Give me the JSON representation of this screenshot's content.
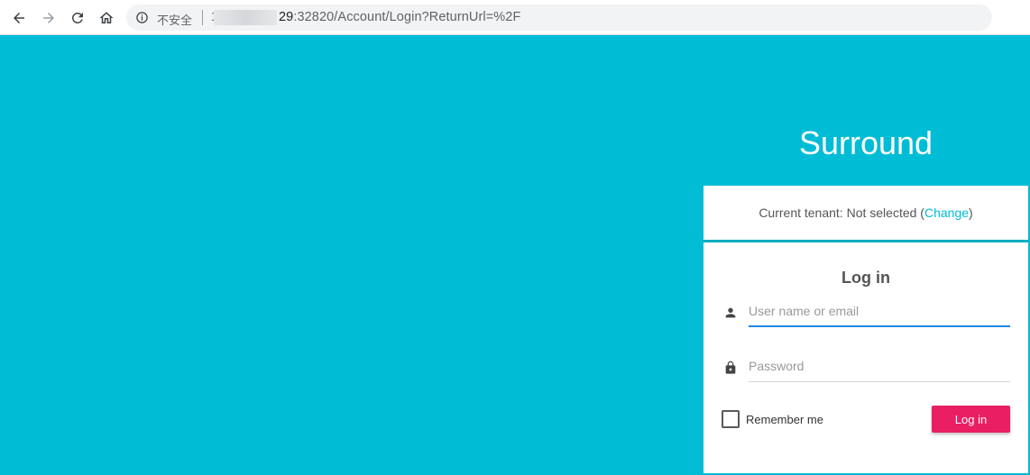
{
  "browser": {
    "security_label": "不安全",
    "url_prefix": "1",
    "url_host": "29",
    "url_path": ":32820/Account/Login?ReturnUrl=%2F"
  },
  "app": {
    "brand": "Surround"
  },
  "tenant": {
    "prefix": "Current tenant: Not selected (",
    "change_link": "Change",
    "suffix": ")"
  },
  "login": {
    "title": "Log in",
    "username_placeholder": "User name or email",
    "password_placeholder": "Password",
    "remember_label": "Remember me",
    "submit_label": "Log in"
  },
  "colors": {
    "background": "#00bcd4",
    "primary_button": "#e91e63",
    "active_underline": "#1e88e5",
    "link": "#00bcd4"
  },
  "icons": {
    "back": "back-arrow-icon",
    "forward": "forward-arrow-icon",
    "reload": "reload-icon",
    "home": "home-icon",
    "info": "info-icon",
    "user": "person-icon",
    "password": "lock-icon"
  }
}
